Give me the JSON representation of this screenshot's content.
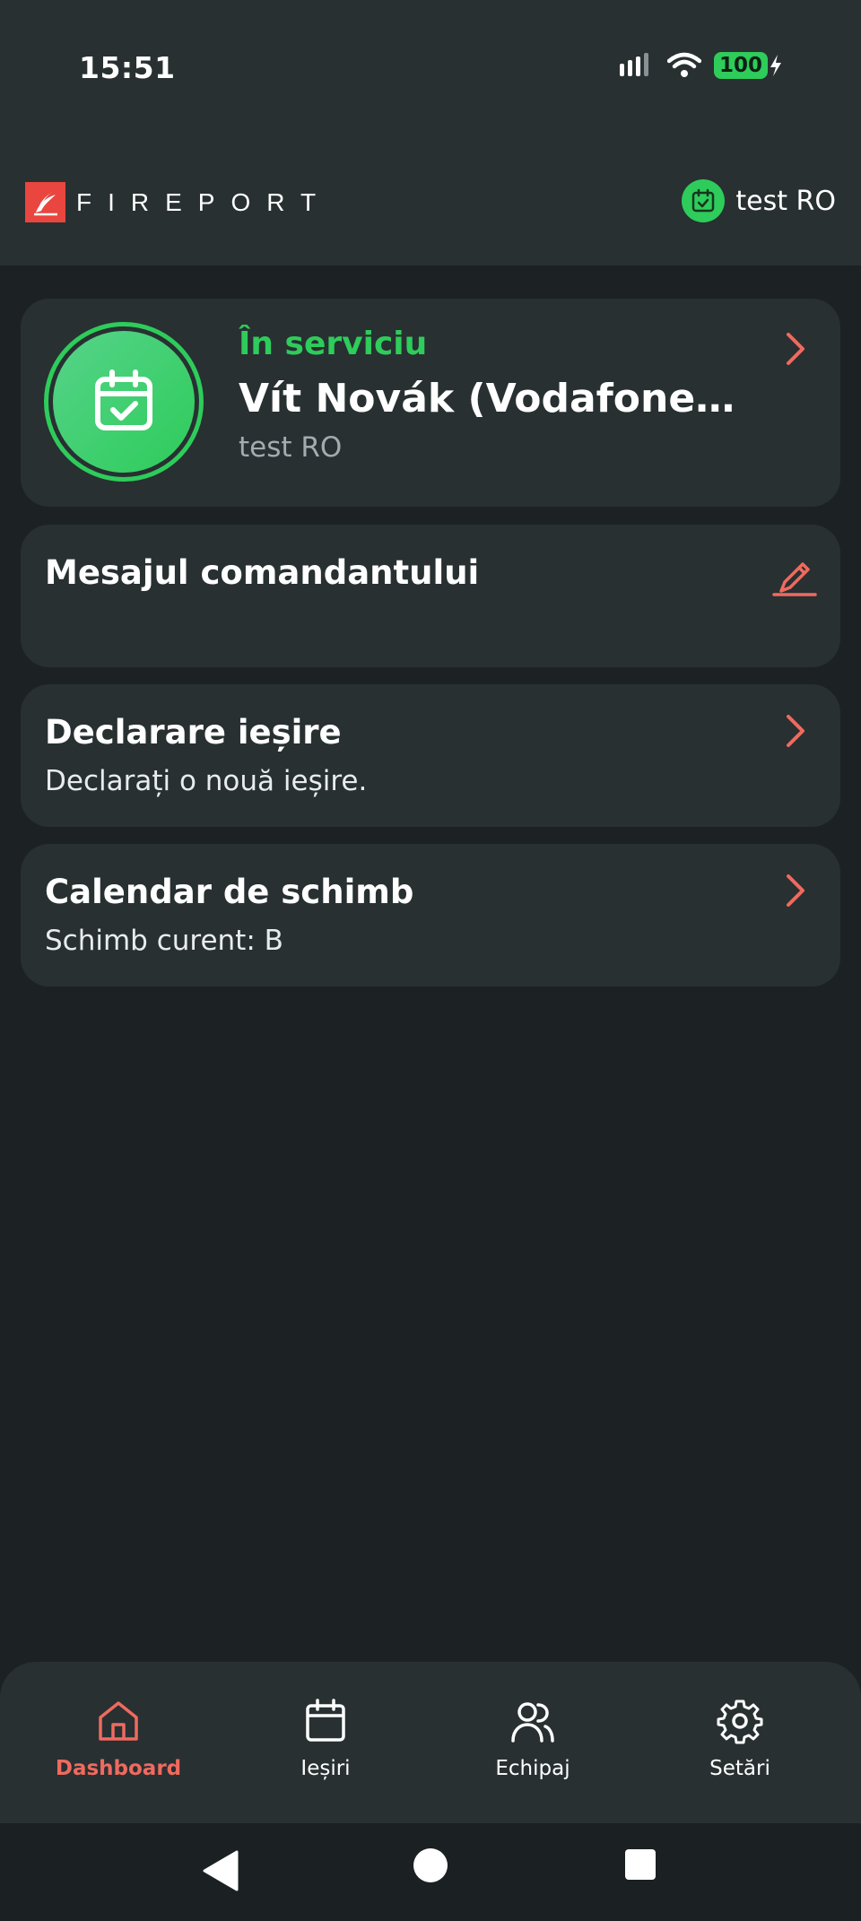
{
  "status_bar": {
    "time": "15:51",
    "battery": "100"
  },
  "header": {
    "brand_name": "FIREPORT",
    "user_name": "test RO"
  },
  "duty_card": {
    "status": "În serviciu",
    "person": "Vít Novák (Vodafone C...",
    "unit": "test RO"
  },
  "commander_card": {
    "title": "Mesajul comandantului"
  },
  "declare_card": {
    "title": "Declarare ieșire",
    "subtitle": "Declarați o nouă ieșire."
  },
  "shift_card": {
    "title": "Calendar de schimb",
    "subtitle": "Schimb curent: B"
  },
  "bottom_nav": {
    "items": [
      {
        "label": "Dashboard",
        "icon": "home-icon",
        "active": true
      },
      {
        "label": "Ieșiri",
        "icon": "calendar-icon",
        "active": false
      },
      {
        "label": "Echipaj",
        "icon": "users-icon",
        "active": false
      },
      {
        "label": "Setări",
        "icon": "gear-icon",
        "active": false
      }
    ]
  },
  "colors": {
    "accent": "#ef6a5f",
    "success": "#2ecc5a",
    "surface": "#283032",
    "background": "#1c2224"
  }
}
